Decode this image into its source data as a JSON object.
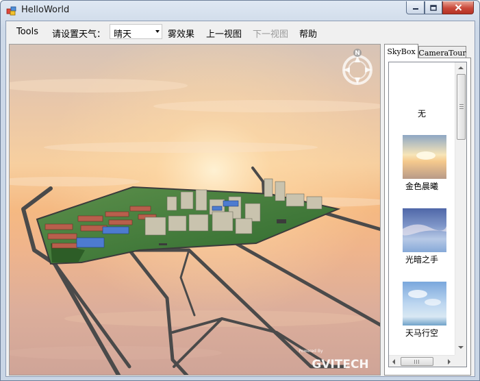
{
  "window": {
    "title": "HelloWorld"
  },
  "menu": {
    "tools": "Tools",
    "weather_label": "请设置天气：",
    "weather_value": "晴天",
    "fog": "雾效果",
    "prev_view": "上一视图",
    "next_view": "下一视图",
    "help": "帮助"
  },
  "viewport": {
    "compass_label": "N",
    "logo_caption": "Powered By",
    "logo_text": "GVITECH"
  },
  "side_panel": {
    "tabs": [
      {
        "label": "SkyBox",
        "active": true
      },
      {
        "label": "CameraTour",
        "active": false
      }
    ],
    "skybox_items": [
      {
        "label": "无",
        "thumbnail": "none"
      },
      {
        "label": "金色晨曦",
        "thumbnail": "golden-dawn"
      },
      {
        "label": "光暗之手",
        "thumbnail": "light-dark-hand"
      },
      {
        "label": "天马行空",
        "thumbnail": "pegasus-sky"
      }
    ]
  },
  "icons": {
    "app": "app-icon",
    "minimize": "minimize-icon",
    "maximize": "maximize-icon",
    "close": "close-icon",
    "dropdown": "chevron-down-icon",
    "compass": "compass-icon"
  },
  "colors": {
    "sky_top": "#d9c3b3",
    "sky_mid": "#f4c49a",
    "sky_horizon": "#f8b57e",
    "road": "#4a4a4a",
    "grass": "#3f7d36",
    "close_button": "#c9483a"
  }
}
